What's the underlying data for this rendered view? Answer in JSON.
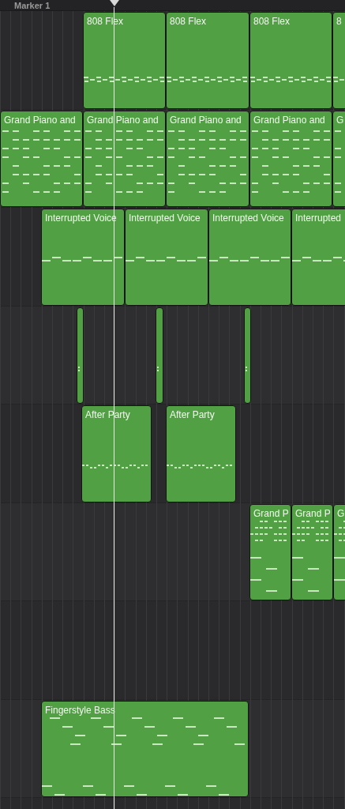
{
  "marker": {
    "label": "Marker 1"
  },
  "tracks": [
    {
      "regions": [
        {
          "name": "808 Flex",
          "kind": "drum"
        },
        {
          "name": "808 Flex",
          "kind": "drum"
        },
        {
          "name": "808 Flex",
          "kind": "drum"
        },
        {
          "name": "8",
          "kind": "drum"
        }
      ]
    },
    {
      "regions": [
        {
          "name": "Grand Piano and",
          "kind": "chords"
        },
        {
          "name": "Grand Piano and",
          "kind": "chords"
        },
        {
          "name": "Grand Piano and",
          "kind": "chords"
        },
        {
          "name": "Grand Piano and",
          "kind": "chords"
        },
        {
          "name": "G",
          "kind": "chords"
        }
      ]
    },
    {
      "regions": [
        {
          "name": "Interrupted Voice",
          "kind": "voice"
        },
        {
          "name": "Interrupted Voice",
          "kind": "voice"
        },
        {
          "name": "Interrupted Voice",
          "kind": "voice"
        },
        {
          "name": "Interrupted",
          "kind": "voice"
        }
      ]
    },
    {
      "regions": [
        {
          "kind": "sliver"
        },
        {
          "kind": "sliver"
        },
        {
          "kind": "sliver"
        }
      ]
    },
    {
      "regions": [
        {
          "name": "After Party",
          "kind": "arp"
        },
        {
          "name": "After Party",
          "kind": "arp"
        }
      ]
    },
    {
      "regions": [
        {
          "name": "Grand P",
          "kind": "keys"
        },
        {
          "name": "Grand P",
          "kind": "keys"
        },
        {
          "name": "G",
          "kind": "keys"
        }
      ]
    },
    {
      "regions": [
        {
          "name": "Fingerstyle Bass",
          "kind": "bass"
        }
      ]
    }
  ]
}
